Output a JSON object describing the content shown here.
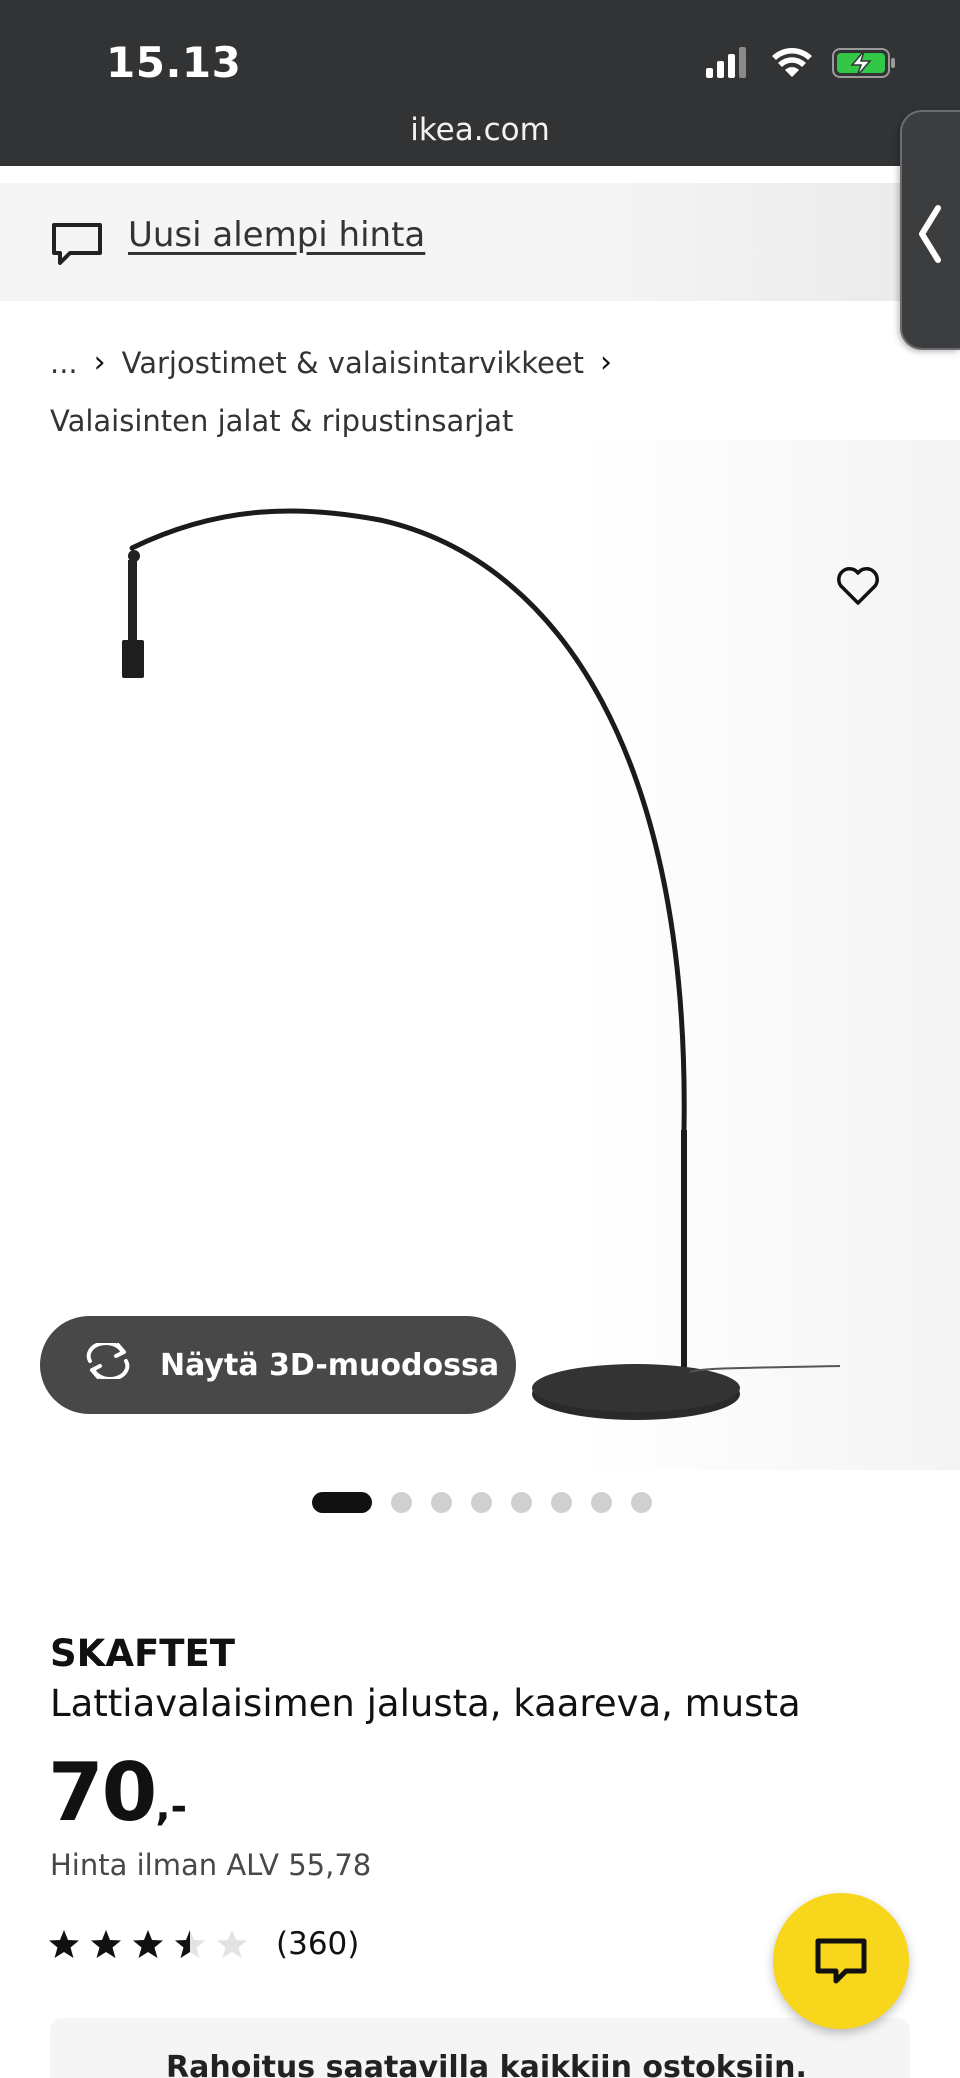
{
  "status_bar": {
    "time": "15.13",
    "icons": [
      "signal-icon",
      "wifi-icon",
      "battery-charging-icon"
    ]
  },
  "browser": {
    "url": "ikea.com"
  },
  "promo": {
    "link": "Uusi alempi hinta",
    "icon": "speech-bubble-icon"
  },
  "breadcrumb": {
    "ellipsis": "...",
    "parent": "Varjostimet & valaisintarvikkeet",
    "current": "Valaisinten jalat & ripustinsarjat"
  },
  "gallery": {
    "button_3d": "Näytä 3D-muodossa",
    "image_count": 8,
    "active_index": 0
  },
  "product": {
    "name": "SKAFTET",
    "description": "Lattiavalaisimen jalusta, kaareva, musta",
    "price_integer": "70",
    "price_suffix": ",-",
    "vat_text": "Hinta ilman ALV 55,78",
    "rating_value": 3.5,
    "rating_max": 5,
    "rating_count": "(360)"
  },
  "finance": {
    "text": "Rahoitus saatavilla kaikkiin ostoksiin."
  },
  "colors": {
    "accent_yellow": "#f7d61b",
    "dark": "#111111",
    "bar": "#313335"
  }
}
